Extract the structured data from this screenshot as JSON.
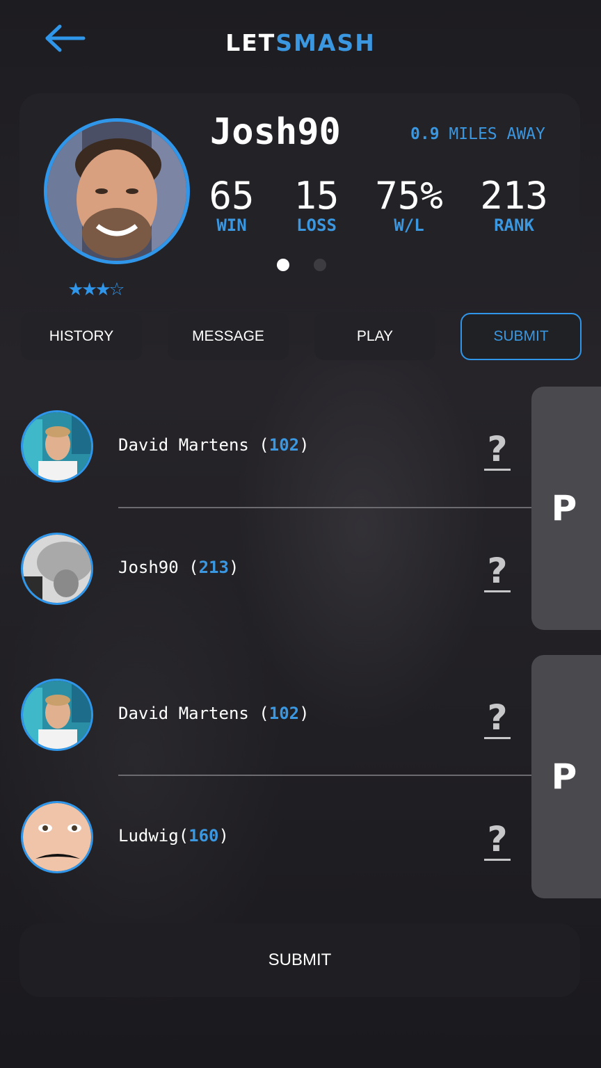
{
  "header": {
    "title_part1": "LET",
    "title_part2": "SMASH"
  },
  "profile": {
    "username": "Josh90",
    "distance_value": "0.9",
    "distance_label": "MILES AWAY",
    "stats": [
      {
        "value": "65",
        "label": "WIN"
      },
      {
        "value": "15",
        "label": "LOSS"
      },
      {
        "value": "75%",
        "label": "W/L"
      },
      {
        "value": "213",
        "label": "RANK"
      }
    ],
    "rating": {
      "value": 3,
      "max": 4
    },
    "page_indicator": {
      "current": 1,
      "total": 2
    }
  },
  "tabs": [
    {
      "label": "HISTORY"
    },
    {
      "label": "MESSAGE"
    },
    {
      "label": "PLAY"
    },
    {
      "label": "SUBMIT",
      "active": true
    }
  ],
  "matches": [
    {
      "players": [
        {
          "name": "David Martens",
          "rank": "102"
        },
        {
          "name": "Josh90",
          "rank": "213"
        }
      ],
      "result_label": "P"
    },
    {
      "players": [
        {
          "name": "David Martens",
          "rank": "102"
        },
        {
          "name": "Ludwig",
          "rank": "160"
        }
      ],
      "result_label": "P"
    }
  ],
  "player_result_placeholder": "?",
  "footer": {
    "submit_label": "SUBMIT"
  },
  "colors": {
    "accent": "#3a97e0",
    "background": "#1b1a1e",
    "card": "#232227"
  }
}
